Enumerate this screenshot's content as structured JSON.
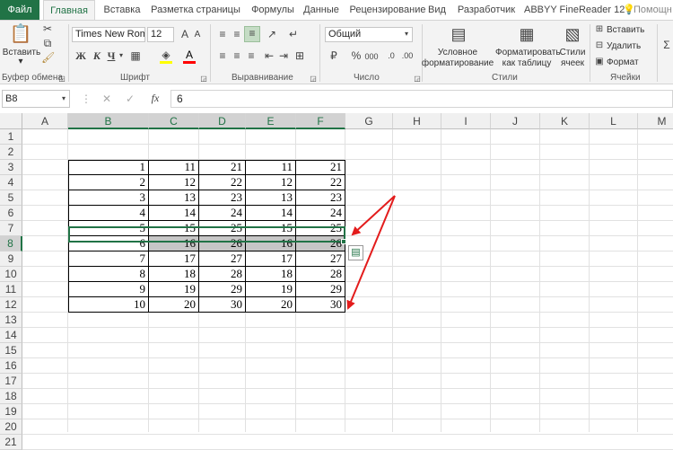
{
  "tabs": [
    "Файл",
    "Главная",
    "Вставка",
    "Разметка страницы",
    "Формулы",
    "Данные",
    "Рецензирование",
    "Вид",
    "Разработчик",
    "ABBYY FineReader 12"
  ],
  "tell_me": "Помощн",
  "ribbon": {
    "paste_label": "Вставить",
    "clipboard_label": "Буфер обмена",
    "font_name": "Times New Roma",
    "font_size": "12",
    "font_label": "Шрифт",
    "bold": "Ж",
    "italic": "К",
    "underline": "Ч",
    "grow_font": "A",
    "shrink_font": "A",
    "align_label": "Выравнивание",
    "number_format": "Общий",
    "number_label": "Число",
    "percent": "%",
    "thousands": "000",
    "cond_format_1": "Условное",
    "cond_format_2": "форматирование",
    "format_table_1": "Форматировать",
    "format_table_2": "как таблицу",
    "cell_styles_1": "Стили",
    "cell_styles_2": "ячеек",
    "styles_label": "Стили",
    "insert": "Вставить",
    "delete": "Удалить",
    "format": "Формат",
    "cells_label": "Ячейки"
  },
  "formula_bar": {
    "name_box": "B8",
    "fx": "fx",
    "value": "6"
  },
  "columns": [
    "A",
    "B",
    "C",
    "D",
    "E",
    "F",
    "G",
    "H",
    "I",
    "J",
    "K",
    "L",
    "M"
  ],
  "rows": [
    "1",
    "2",
    "3",
    "4",
    "5",
    "6",
    "7",
    "8",
    "9",
    "10",
    "11",
    "12",
    "13",
    "14",
    "15",
    "16",
    "17",
    "18",
    "19",
    "20",
    "21"
  ],
  "table": [
    [
      "1",
      "11",
      "21",
      "11",
      "21"
    ],
    [
      "2",
      "12",
      "22",
      "12",
      "22"
    ],
    [
      "3",
      "13",
      "23",
      "13",
      "23"
    ],
    [
      "4",
      "14",
      "24",
      "14",
      "24"
    ],
    [
      "5",
      "15",
      "25",
      "15",
      "25"
    ],
    [
      "6",
      "16",
      "26",
      "16",
      "26"
    ],
    [
      "7",
      "17",
      "27",
      "17",
      "27"
    ],
    [
      "8",
      "18",
      "28",
      "18",
      "28"
    ],
    [
      "9",
      "19",
      "29",
      "19",
      "29"
    ],
    [
      "10",
      "20",
      "30",
      "20",
      "30"
    ]
  ],
  "colors": {
    "accent": "#217346",
    "arrow": "#e31c1c",
    "highlight": "#c6c6c6"
  }
}
